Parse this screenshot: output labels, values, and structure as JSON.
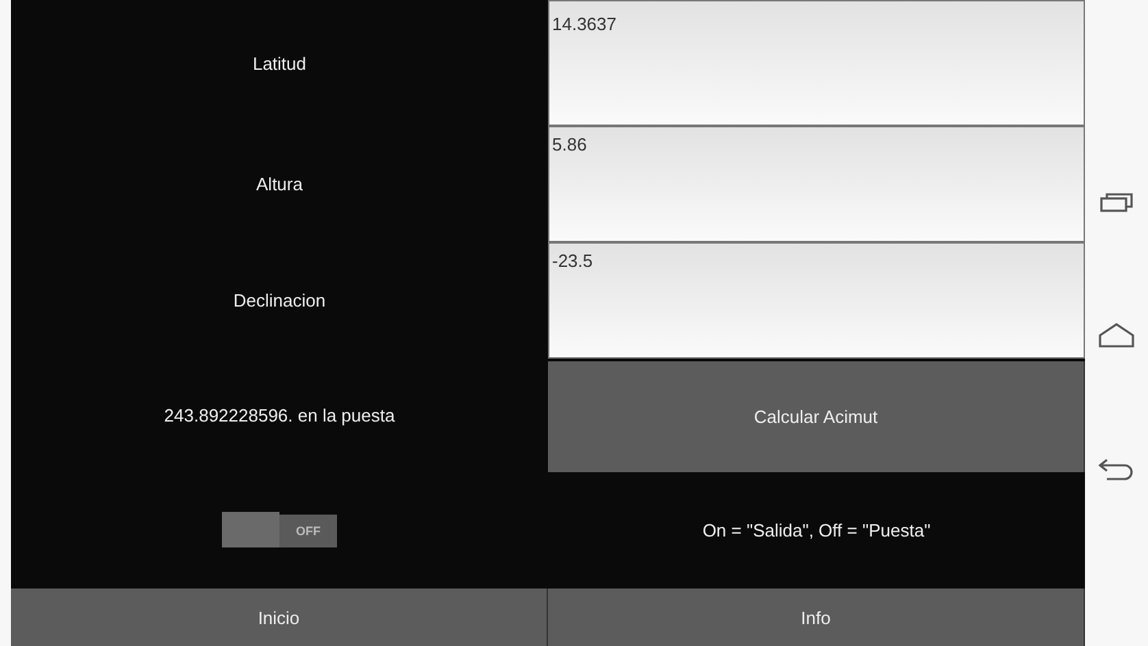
{
  "fields": [
    {
      "label": "Latitud",
      "value": "14.3637"
    },
    {
      "label": "Altura",
      "value": "5.86"
    },
    {
      "label": "Declinacion",
      "value": "-23.5"
    }
  ],
  "result": "243.892228596. en la puesta",
  "calculate_button": "Calcular Acimut",
  "toggle": {
    "on": false,
    "state_label": "OFF"
  },
  "toggle_hint": "On = \"Salida\", Off = \"Puesta\"",
  "bottom_buttons": [
    "Inicio",
    "Info"
  ]
}
